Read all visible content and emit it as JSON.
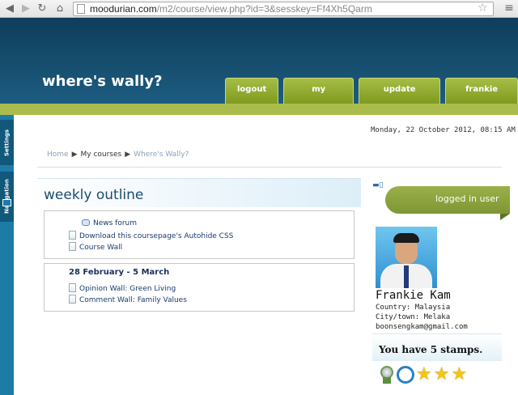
{
  "browser": {
    "url_host": "moodurian.com",
    "url_path": "/m2/course/view.php?id=3&sesskey=Ff4Xh5Qarm"
  },
  "header": {
    "site_title": "where's wally?",
    "tabs": [
      "logout",
      "my courses",
      "update profile",
      "frankie kam"
    ]
  },
  "dock": {
    "tabs": [
      "Settings",
      "Navigation"
    ]
  },
  "datetime": "Monday, 22 October 2012, 08:15 AM",
  "breadcrumb": [
    "Home",
    "My courses",
    "Where's Wally?"
  ],
  "main": {
    "title": "weekly outline",
    "section0_items": [
      "News forum",
      "Download this coursepage's Autohide CSS",
      "Course Wall"
    ],
    "section1": {
      "title": "28 February - 5 March",
      "items": [
        "Opinion Wall: Green Living",
        "Comment Wall: Family Values"
      ]
    }
  },
  "user_block": {
    "title": "logged in user",
    "name": "Frankie Kam",
    "country": "Country: Malaysia",
    "city": "City/town: Melaka",
    "email": "boonsengkam@gmail.com"
  },
  "stamps": {
    "text": "You have 5 stamps.",
    "count": 5,
    "icons": [
      "award-rosette",
      "clock",
      "star",
      "star",
      "star"
    ]
  },
  "colors": {
    "header": "#1d5c80",
    "accent_green": "#aabd4c",
    "dock": "#1d7ba8"
  }
}
